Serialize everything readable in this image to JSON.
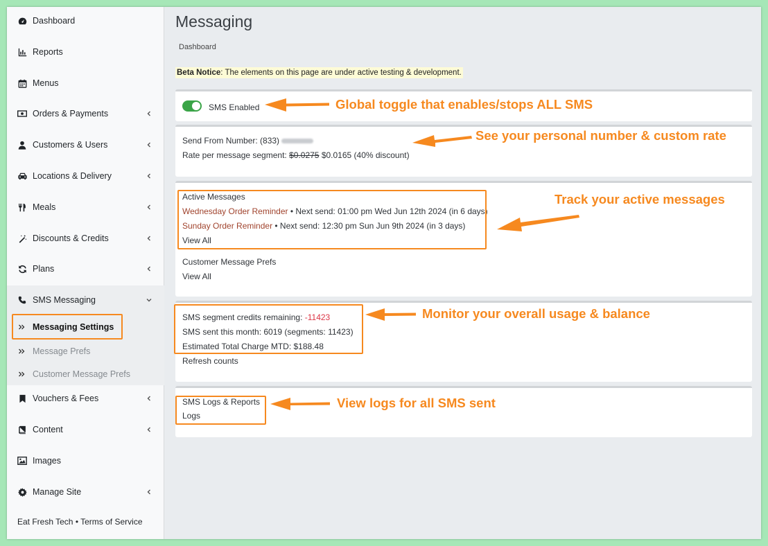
{
  "sidebar": {
    "items": [
      {
        "label": "Dashboard",
        "icon": "tachometer-icon"
      },
      {
        "label": "Reports",
        "icon": "bar-chart-icon"
      },
      {
        "label": "Menus",
        "icon": "calendar-icon"
      },
      {
        "label": "Orders & Payments",
        "icon": "money-icon"
      },
      {
        "label": "Customers & Users",
        "icon": "user-icon"
      },
      {
        "label": "Locations & Delivery",
        "icon": "car-icon"
      },
      {
        "label": "Meals",
        "icon": "utensils-icon"
      },
      {
        "label": "Discounts & Credits",
        "icon": "magic-wand-icon"
      },
      {
        "label": "Plans",
        "icon": "refresh-icon"
      },
      {
        "label": "SMS Messaging",
        "icon": "phone-icon"
      },
      {
        "label": "Vouchers & Fees",
        "icon": "bookmark-icon"
      },
      {
        "label": "Content",
        "icon": "book-icon"
      },
      {
        "label": "Images",
        "icon": "image-icon"
      },
      {
        "label": "Manage Site",
        "icon": "gear-icon"
      }
    ],
    "sub_items": [
      {
        "label": "Messaging Settings"
      },
      {
        "label": "Message Prefs"
      },
      {
        "label": "Customer Message Prefs"
      }
    ],
    "footer": "Eat Fresh Tech • Terms of Service"
  },
  "main": {
    "title": "Messaging",
    "breadcrumb": "Dashboard",
    "beta_label": "Beta Notice",
    "beta_text": ": The elements on this page are under active testing & development.",
    "sms_toggle_label": "SMS Enabled",
    "send_from_label": "Send From Number: (833)",
    "rate_label": "Rate per message segment:",
    "rate_old": "$0.0275",
    "rate_new": "$0.0165 (40% discount)",
    "active_messages_title": "Active Messages",
    "active_messages": [
      {
        "name": "Wednesday Order Reminder",
        "next": " • Next send: 01:00 pm Wed Jun 12th 2024 (in 6 days)"
      },
      {
        "name": "Sunday Order Reminder",
        "next": " • Next send: 12:30 pm Sun Jun 9th 2024 (in 3 days)"
      }
    ],
    "view_all": "View All",
    "customer_prefs_title": "Customer Message Prefs",
    "credits_label": "SMS segment credits remaining: ",
    "credits_value": "-11423",
    "sent_month": "SMS sent this month: 6019 (segments: 11423)",
    "estimated_charge": "Estimated Total Charge MTD: $188.48",
    "refresh_counts": "Refresh counts",
    "logs_title": "SMS Logs & Reports",
    "logs_link": "Logs"
  },
  "annotations": {
    "toggle": "Global toggle that enables/stops ALL SMS",
    "number": "See your personal number & custom rate",
    "active": "Track your active messages",
    "usage": "Monitor your overall usage & balance",
    "logs": "View logs for all SMS sent"
  },
  "colors": {
    "accent": "#f6891f",
    "link": "#a0432d",
    "toggle_on": "#3aa447",
    "negative": "#dc3545"
  }
}
